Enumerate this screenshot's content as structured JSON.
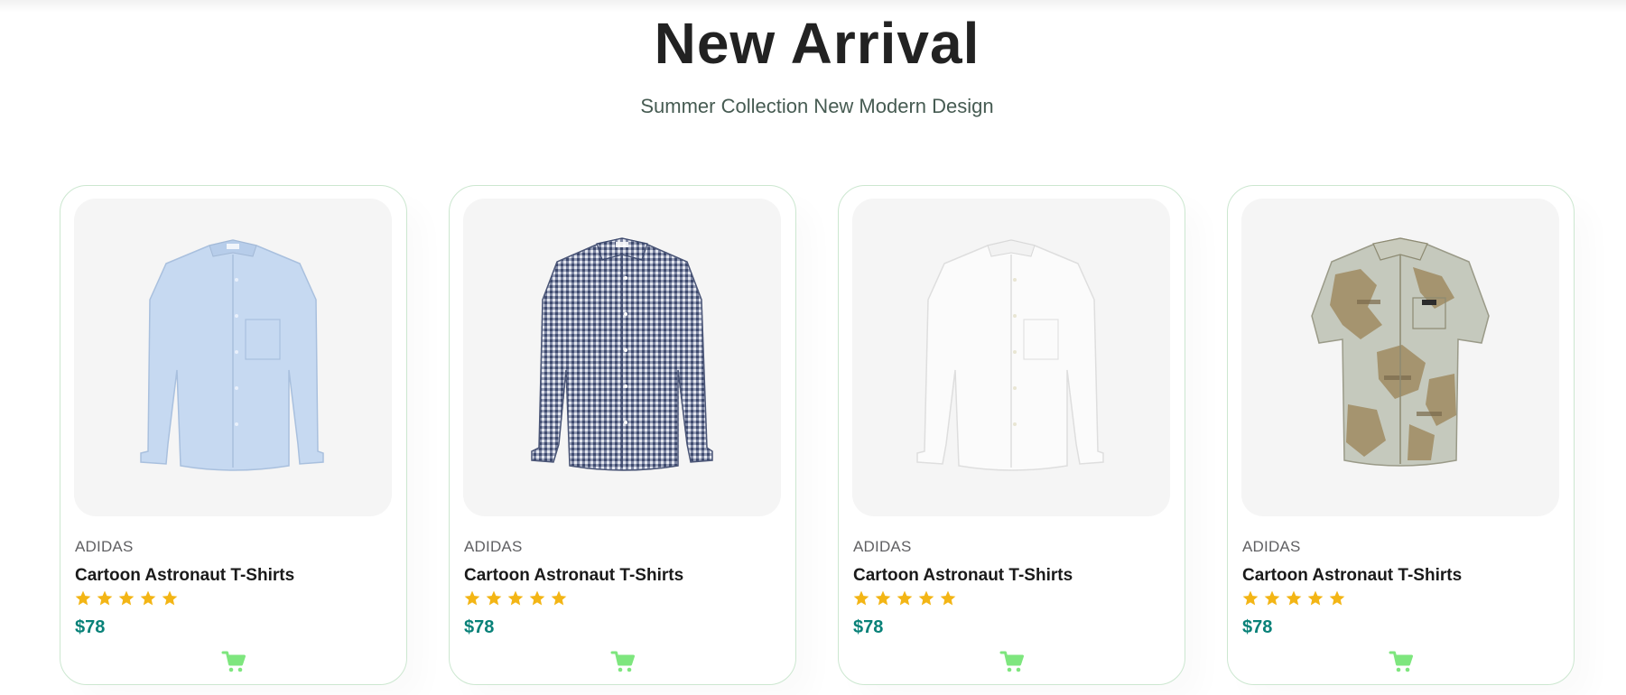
{
  "section": {
    "title": "New Arrival",
    "subtitle": "Summer Collection New Modern Design"
  },
  "colors": {
    "accent": "#088178",
    "star": "#f3b515",
    "cart": "#7ee67e",
    "card_border": "#cce7d0",
    "image_bg": "#f5f5f5"
  },
  "products": [
    {
      "brand": "ADIDAS",
      "name": "Cartoon Astronaut T-Shirts",
      "rating": 5,
      "price": "$78",
      "image": "light-blue-oxford-shirt",
      "icon": "shopping-cart-icon"
    },
    {
      "brand": "ADIDAS",
      "name": "Cartoon Astronaut T-Shirts",
      "rating": 5,
      "price": "$78",
      "image": "navy-gingham-shirt",
      "icon": "shopping-cart-icon"
    },
    {
      "brand": "ADIDAS",
      "name": "Cartoon Astronaut T-Shirts",
      "rating": 5,
      "price": "$78",
      "image": "white-linen-shirt",
      "icon": "shopping-cart-icon"
    },
    {
      "brand": "ADIDAS",
      "name": "Cartoon Astronaut T-Shirts",
      "rating": 5,
      "price": "$78",
      "image": "printed-short-sleeve-shirt",
      "icon": "shopping-cart-icon"
    }
  ]
}
